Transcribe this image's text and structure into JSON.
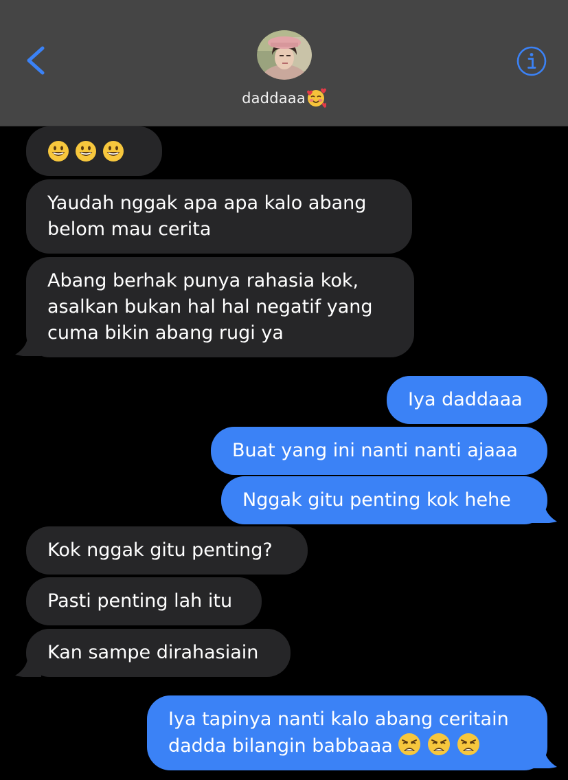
{
  "header": {
    "contact_name": "daddaaa",
    "contact_emoji": "smiling-face-with-hearts",
    "back_icon": "chevron-left-icon",
    "info_icon": "info-circle-icon"
  },
  "colors": {
    "accent": "#3b82f6",
    "incoming_bubble": "#262628",
    "header_bg": "#454545"
  },
  "messages": [
    {
      "direction": "incoming",
      "text": "",
      "emojis": [
        "grinning-face",
        "grinning-face",
        "grinning-face"
      ]
    },
    {
      "direction": "incoming",
      "lines": [
        "Yaudah nggak apa apa kalo abang",
        "belom mau cerita"
      ]
    },
    {
      "direction": "incoming",
      "lines": [
        "Abang berhak punya rahasia kok,",
        "asalkan bukan hal hal negatif yang",
        "cuma bikin abang rugi ya"
      ]
    },
    {
      "direction": "outgoing",
      "text": "Iya daddaaa"
    },
    {
      "direction": "outgoing",
      "text": "Buat yang ini nanti nanti ajaaa"
    },
    {
      "direction": "outgoing",
      "text": "Nggak gitu penting kok hehe"
    },
    {
      "direction": "incoming",
      "text": "Kok nggak gitu penting?"
    },
    {
      "direction": "incoming",
      "text": "Pasti penting lah itu"
    },
    {
      "direction": "incoming",
      "text": "Kan sampe dirahasiain"
    },
    {
      "direction": "outgoing",
      "lines": [
        "Iya tapinya nanti kalo abang ceritain",
        "dadda bilangin babbaaa"
      ],
      "trailing_emojis": [
        "weary-face",
        "weary-face",
        "weary-face"
      ]
    }
  ]
}
